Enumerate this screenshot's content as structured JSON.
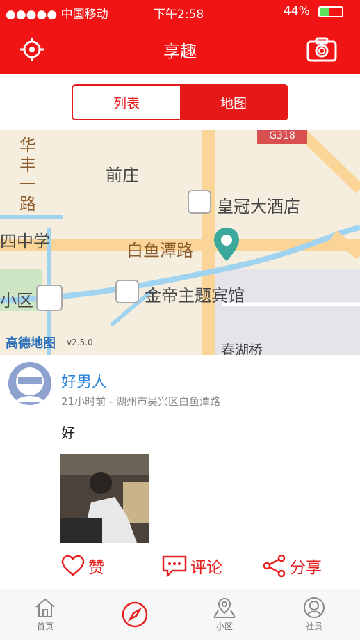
{
  "status_bar": {
    "carrier": "●●●●● 中国移动",
    "time": "下午2:58",
    "battery": "44%"
  },
  "nav": {
    "title": "享趣",
    "locate_icon": "locate-icon",
    "camera_icon": "camera-icon"
  },
  "segments": {
    "list_label": "列表",
    "map_label": "地图",
    "selected": "地图"
  },
  "map": {
    "labels": [
      "华丰一路",
      "前庄",
      "皇冠大酒店",
      "四中学",
      "白鱼潭路",
      "小区",
      "金帝主题宾馆",
      "春湖桥",
      "G318"
    ],
    "watermark": "高德地图",
    "version": "v2.5.0"
  },
  "post": {
    "user_name": "好男人",
    "meta": "21小时前 - 湖州市吴兴区白鱼潭路",
    "content": "好"
  },
  "actions": {
    "like": "赞",
    "comment": "评论",
    "share": "分享"
  },
  "tabs": {
    "home": "首页",
    "community": "小区",
    "members": "社员"
  },
  "colors": {
    "brand_red": "#f01414",
    "link_blue": "#2a83d8"
  }
}
